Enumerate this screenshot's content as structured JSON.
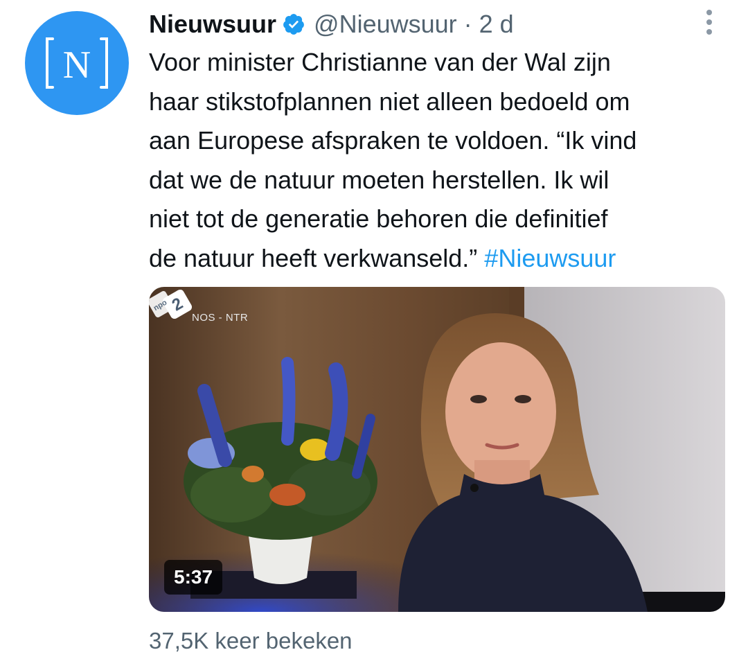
{
  "account": {
    "display_name": "Nieuwsuur",
    "handle": "@Nieuwsuur",
    "separator": "·",
    "time": "2 d",
    "avatar_letter": "N",
    "avatar_color": "#2e96f2",
    "verified_icon": "verified-badge-icon"
  },
  "tweet": {
    "lines": [
      "Voor minister Christianne van der Wal zijn",
      "haar stikstofplannen niet alleen bedoeld om",
      "aan Europese afspraken te voldoen. “Ik vind",
      "dat we de natuur moeten herstellen. Ik wil",
      "niet tot de generatie behoren die definitief"
    ],
    "last_line_text": "de natuur heeft verkwanseld.”",
    "hashtag": "#Nieuwsuur"
  },
  "media": {
    "source_label": "NOS - NTR",
    "channel_logo": "npo-2-logo",
    "channel_logo_text": "npo",
    "channel_number": "2",
    "duration": "5:37"
  },
  "stats": {
    "views": "37,5K keer bekeken"
  },
  "colors": {
    "link": "#1d9bf0",
    "secondary_text": "#536471",
    "verified": "#1d9bf0"
  }
}
